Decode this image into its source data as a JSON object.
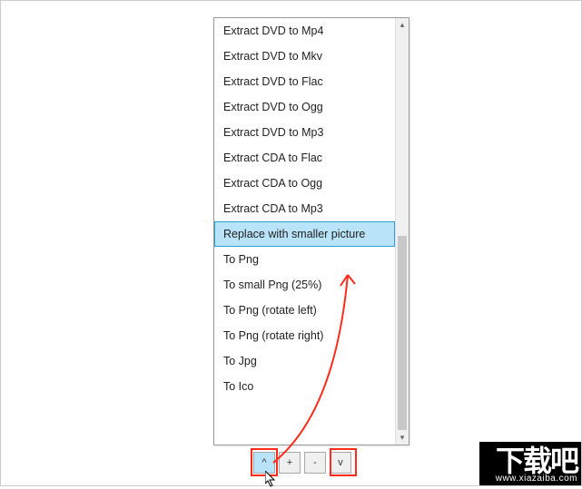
{
  "dropdown": {
    "items": [
      {
        "label": "Extract DVD to Mp4",
        "selected": false
      },
      {
        "label": "Extract DVD to Mkv",
        "selected": false
      },
      {
        "label": "Extract DVD to Flac",
        "selected": false
      },
      {
        "label": "Extract DVD to Ogg",
        "selected": false
      },
      {
        "label": "Extract DVD to Mp3",
        "selected": false
      },
      {
        "label": "Extract CDA to Flac",
        "selected": false
      },
      {
        "label": "Extract CDA to Ogg",
        "selected": false
      },
      {
        "label": "Extract CDA to Mp3",
        "selected": false
      },
      {
        "label": "Replace with smaller picture",
        "selected": true
      },
      {
        "label": "To Png",
        "selected": false
      },
      {
        "label": "To small Png (25%)",
        "selected": false
      },
      {
        "label": "To Png (rotate left)",
        "selected": false
      },
      {
        "label": "To Png (rotate right)",
        "selected": false
      },
      {
        "label": "To Jpg",
        "selected": false
      },
      {
        "label": "To Ico",
        "selected": false
      }
    ]
  },
  "toolbar": {
    "up": "^",
    "add": "+",
    "remove": "-",
    "down": "v"
  },
  "watermark": {
    "text": "下载吧",
    "url": "www.xiazaiba.com"
  }
}
